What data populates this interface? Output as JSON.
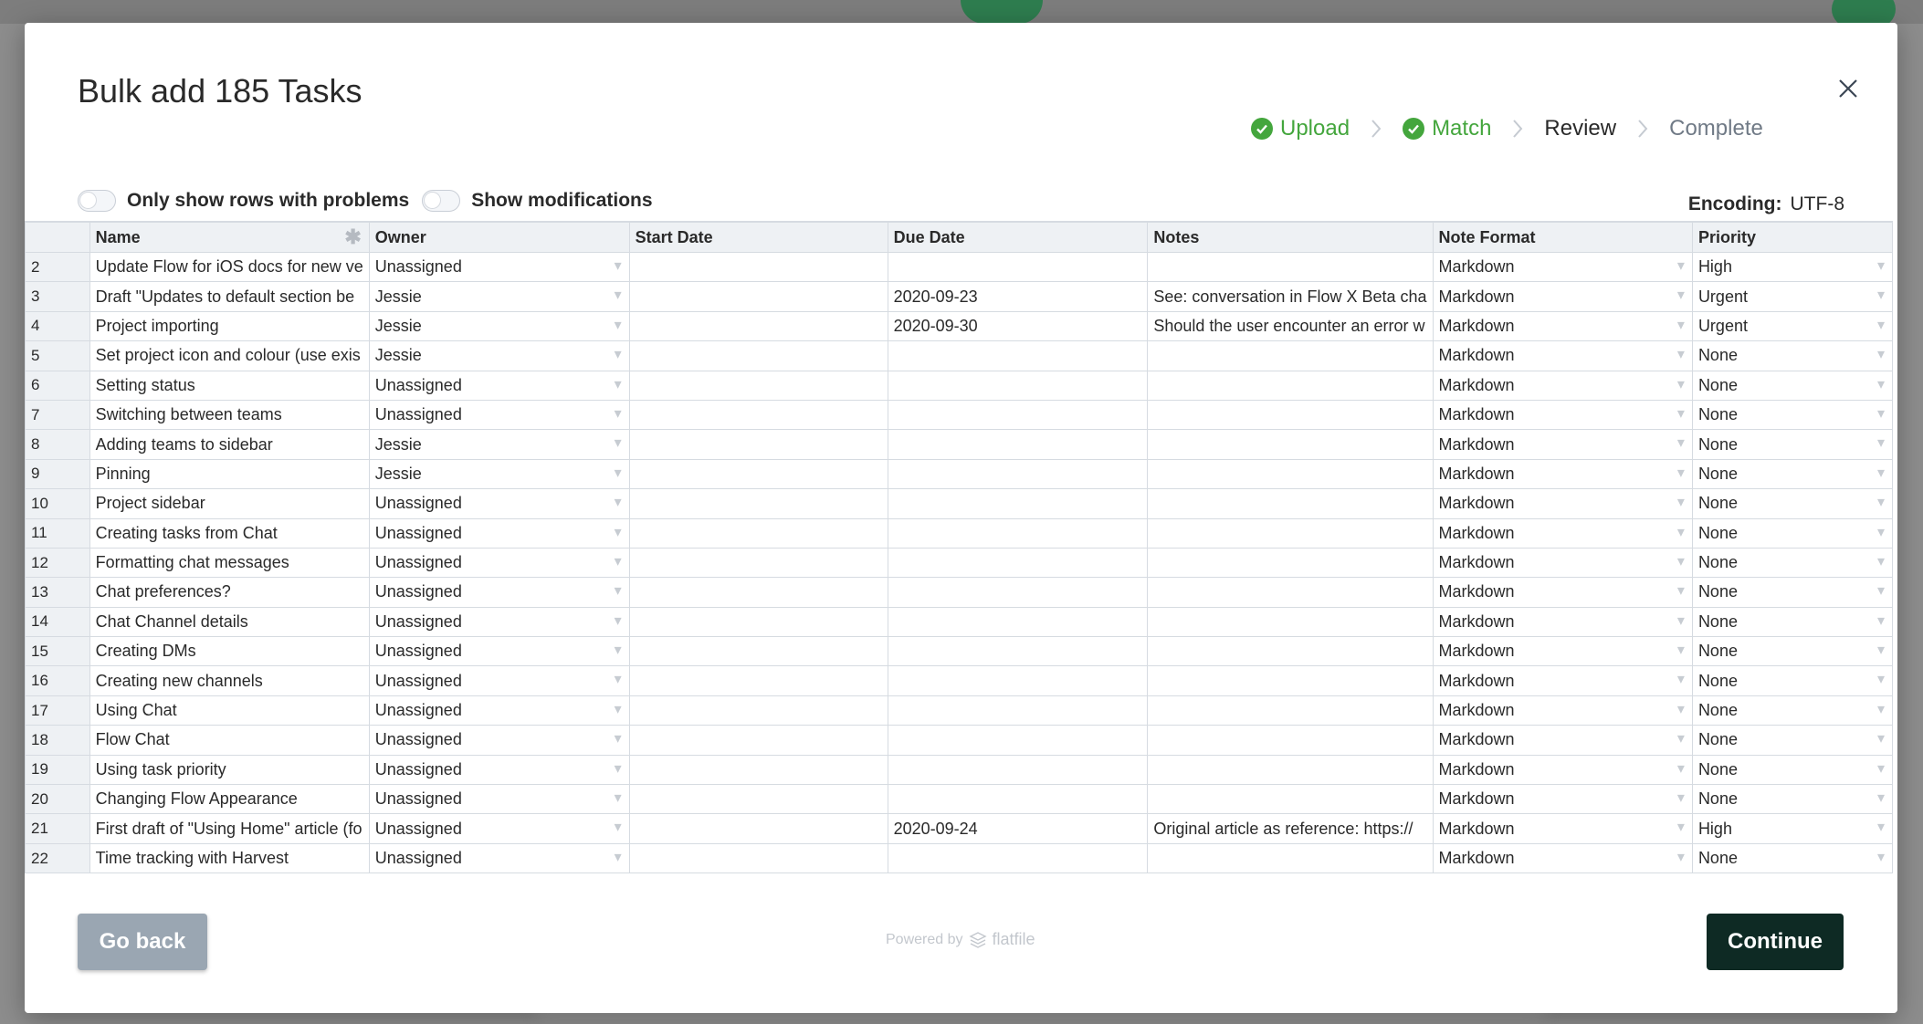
{
  "modal": {
    "title": "Bulk add 185 Tasks",
    "steps": [
      {
        "label": "Upload",
        "state": "done"
      },
      {
        "label": "Match",
        "state": "done"
      },
      {
        "label": "Review",
        "state": "active"
      },
      {
        "label": "Complete",
        "state": "pending"
      }
    ],
    "toggles": {
      "problems_label": "Only show rows with problems",
      "modifications_label": "Show modifications"
    },
    "encoding": {
      "label": "Encoding:",
      "value": "UTF-8"
    },
    "colors": {
      "done": "#44a63d",
      "continue_bg": "#0e2a24",
      "back_bg": "#9aa6b2"
    }
  },
  "table": {
    "columns": [
      "Name",
      "Owner",
      "Start Date",
      "Due Date",
      "Notes",
      "Note Format",
      "Priority"
    ],
    "rows": [
      {
        "n": "2",
        "name": "Update Flow for iOS docs for new ve",
        "owner": "Unassigned",
        "start": "",
        "due": "",
        "notes": "",
        "format": "Markdown",
        "priority": "High"
      },
      {
        "n": "3",
        "name": "Draft \"Updates to default section be",
        "owner": "Jessie",
        "start": "",
        "due": "2020-09-23",
        "notes": "See: conversation in Flow X Beta cha",
        "format": "Markdown",
        "priority": "Urgent"
      },
      {
        "n": "4",
        "name": "Project importing",
        "owner": "Jessie",
        "start": "",
        "due": "2020-09-30",
        "notes": "Should the user encounter an error w",
        "format": "Markdown",
        "priority": "Urgent"
      },
      {
        "n": "5",
        "name": "Set project icon and colour (use exis",
        "owner": "Jessie",
        "start": "",
        "due": "",
        "notes": "",
        "format": "Markdown",
        "priority": "None"
      },
      {
        "n": "6",
        "name": "Setting status",
        "owner": "Unassigned",
        "start": "",
        "due": "",
        "notes": "",
        "format": "Markdown",
        "priority": "None"
      },
      {
        "n": "7",
        "name": "Switching between teams",
        "owner": "Unassigned",
        "start": "",
        "due": "",
        "notes": "",
        "format": "Markdown",
        "priority": "None"
      },
      {
        "n": "8",
        "name": "Adding teams to sidebar",
        "owner": "Jessie",
        "start": "",
        "due": "",
        "notes": "",
        "format": "Markdown",
        "priority": "None"
      },
      {
        "n": "9",
        "name": "Pinning",
        "owner": "Jessie",
        "start": "",
        "due": "",
        "notes": "",
        "format": "Markdown",
        "priority": "None"
      },
      {
        "n": "10",
        "name": "Project sidebar",
        "owner": "Unassigned",
        "start": "",
        "due": "",
        "notes": "",
        "format": "Markdown",
        "priority": "None"
      },
      {
        "n": "11",
        "name": "Creating tasks from Chat",
        "owner": "Unassigned",
        "start": "",
        "due": "",
        "notes": "",
        "format": "Markdown",
        "priority": "None"
      },
      {
        "n": "12",
        "name": "Formatting chat messages",
        "owner": "Unassigned",
        "start": "",
        "due": "",
        "notes": "",
        "format": "Markdown",
        "priority": "None"
      },
      {
        "n": "13",
        "name": "Chat preferences?",
        "owner": "Unassigned",
        "start": "",
        "due": "",
        "notes": "",
        "format": "Markdown",
        "priority": "None"
      },
      {
        "n": "14",
        "name": "Chat Channel details",
        "owner": "Unassigned",
        "start": "",
        "due": "",
        "notes": "",
        "format": "Markdown",
        "priority": "None"
      },
      {
        "n": "15",
        "name": "Creating DMs",
        "owner": "Unassigned",
        "start": "",
        "due": "",
        "notes": "",
        "format": "Markdown",
        "priority": "None"
      },
      {
        "n": "16",
        "name": "Creating new channels",
        "owner": "Unassigned",
        "start": "",
        "due": "",
        "notes": "",
        "format": "Markdown",
        "priority": "None"
      },
      {
        "n": "17",
        "name": "Using Chat",
        "owner": "Unassigned",
        "start": "",
        "due": "",
        "notes": "",
        "format": "Markdown",
        "priority": "None"
      },
      {
        "n": "18",
        "name": "Flow Chat",
        "owner": "Unassigned",
        "start": "",
        "due": "",
        "notes": "",
        "format": "Markdown",
        "priority": "None"
      },
      {
        "n": "19",
        "name": "Using task priority",
        "owner": "Unassigned",
        "start": "",
        "due": "",
        "notes": "",
        "format": "Markdown",
        "priority": "None"
      },
      {
        "n": "20",
        "name": "Changing Flow Appearance",
        "owner": "Unassigned",
        "start": "",
        "due": "",
        "notes": "",
        "format": "Markdown",
        "priority": "None"
      },
      {
        "n": "21",
        "name": "First draft of \"Using Home\" article (fo",
        "owner": "Unassigned",
        "start": "",
        "due": "2020-09-24",
        "notes": "Original article as reference: https://",
        "format": "Markdown",
        "priority": "High"
      },
      {
        "n": "22",
        "name": "Time tracking with Harvest",
        "owner": "Unassigned",
        "start": "",
        "due": "",
        "notes": "",
        "format": "Markdown",
        "priority": "None"
      }
    ]
  },
  "footer": {
    "back_label": "Go back",
    "powered_label": "Powered by",
    "brand": "flatfile",
    "continue_label": "Continue"
  }
}
